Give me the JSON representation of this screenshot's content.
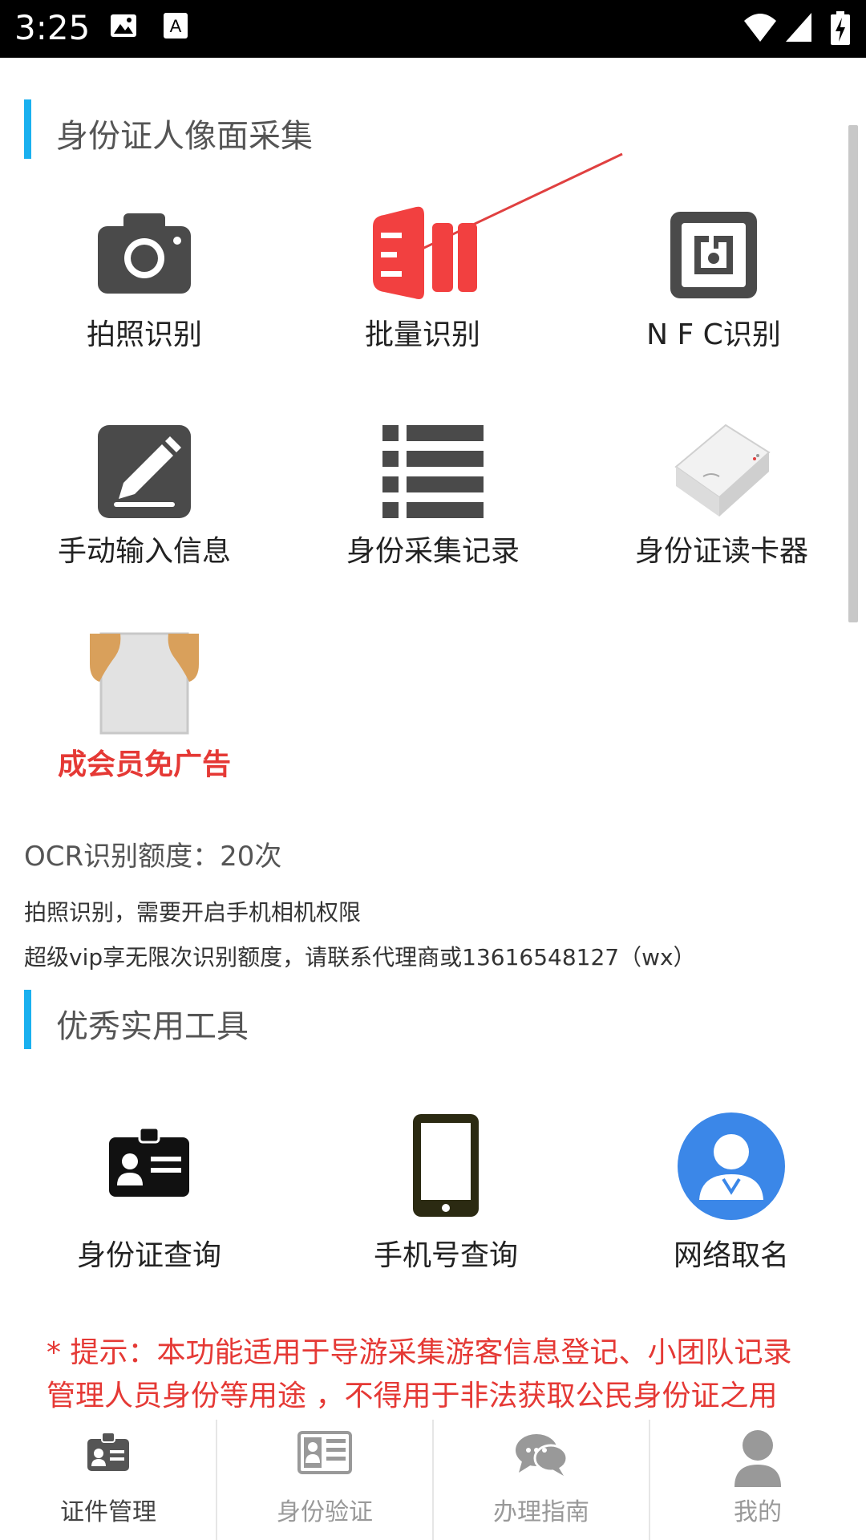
{
  "status_bar": {
    "time": "3:25"
  },
  "section1": {
    "title": "身份证人像面采集",
    "tiles": [
      {
        "label": "拍照识别",
        "icon": "camera-icon"
      },
      {
        "label": "批量识别",
        "icon": "batch-icon"
      },
      {
        "label": "N F C识别",
        "icon": "nfc-icon"
      },
      {
        "label": "手动输入信息",
        "icon": "edit-icon"
      },
      {
        "label": "身份采集记录",
        "icon": "list-icon"
      },
      {
        "label": "身份证读卡器",
        "icon": "card-reader-icon"
      },
      {
        "label": "成会员免广告",
        "icon": "vip-shirt-icon"
      }
    ]
  },
  "info": {
    "quota": "OCR识别额度：20次",
    "line1": "拍照识别，需要开启手机相机权限",
    "line2": "超级vip享无限次识别额度，请联系代理商或13616548127（wx）"
  },
  "section2": {
    "title": "优秀实用工具",
    "tiles": [
      {
        "label": "身份证查询",
        "icon": "id-card-icon"
      },
      {
        "label": "手机号查询",
        "icon": "phone-icon"
      },
      {
        "label": "网络取名",
        "icon": "user-circle-icon"
      }
    ]
  },
  "tip": "* 提示：本功能适用于导游采集游客信息登记、小团队记录管理人员身份等用途 ，不得用于非法获取公民身份证之用",
  "tabs": [
    {
      "label": "证件管理",
      "active": true
    },
    {
      "label": "身份验证",
      "active": false
    },
    {
      "label": "办理指南",
      "active": false
    },
    {
      "label": "我的",
      "active": false
    }
  ],
  "colors": {
    "accent": "#1ab0ef",
    "red": "#e53935",
    "batch_red": "#f24040",
    "user_blue": "#3b87e8"
  }
}
